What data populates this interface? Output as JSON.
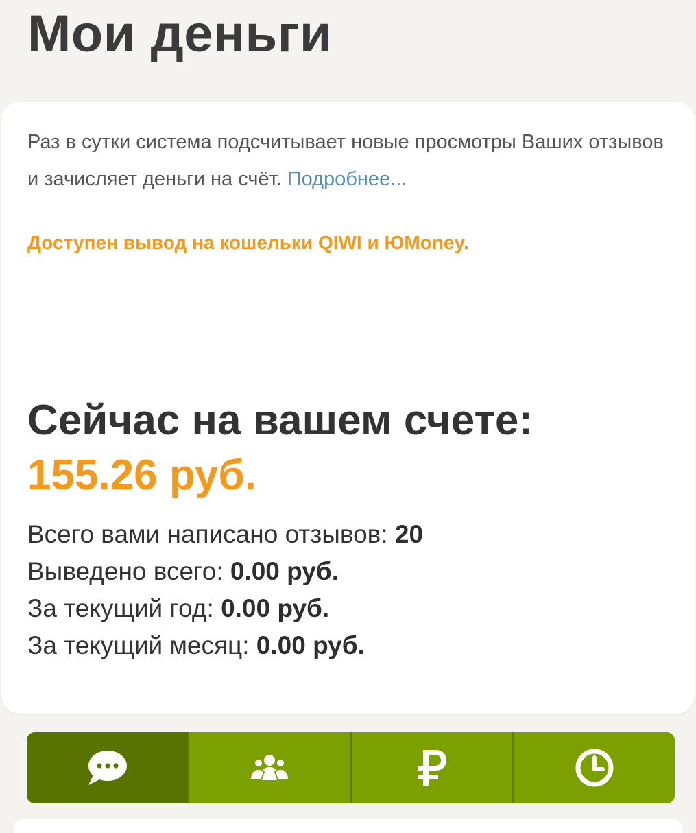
{
  "page": {
    "title": "Мои деньги"
  },
  "info": {
    "text": "Раз в сутки система подсчитывает новые просмотры Ваших отзывов и зачисляет деньги на счёт.",
    "more_link": "Подробнее...",
    "notice": "Доступен вывод на кошельки QIWI и ЮMoney."
  },
  "balance": {
    "heading": "Сейчас на вашем счете:",
    "amount": "155.26 руб."
  },
  "stats": [
    {
      "label": "Всего вами написано отзывов:",
      "value": "20"
    },
    {
      "label": "Выведено всего:",
      "value": "0.00 руб."
    },
    {
      "label": "За текущий год:",
      "value": "0.00 руб."
    },
    {
      "label": "За текущий месяц:",
      "value": "0.00 руб."
    }
  ],
  "tabs": [
    {
      "icon": "chat-bubble-icon",
      "active": true
    },
    {
      "icon": "users-icon",
      "active": false
    },
    {
      "icon": "ruble-icon",
      "active": false
    },
    {
      "icon": "clock-icon",
      "active": false
    }
  ],
  "colors": {
    "accent": "#f39a1c",
    "link": "#5b8db5",
    "tab_bg": "#7ba000",
    "tab_active": "#597300",
    "page_bg": "#f4f3ef"
  }
}
